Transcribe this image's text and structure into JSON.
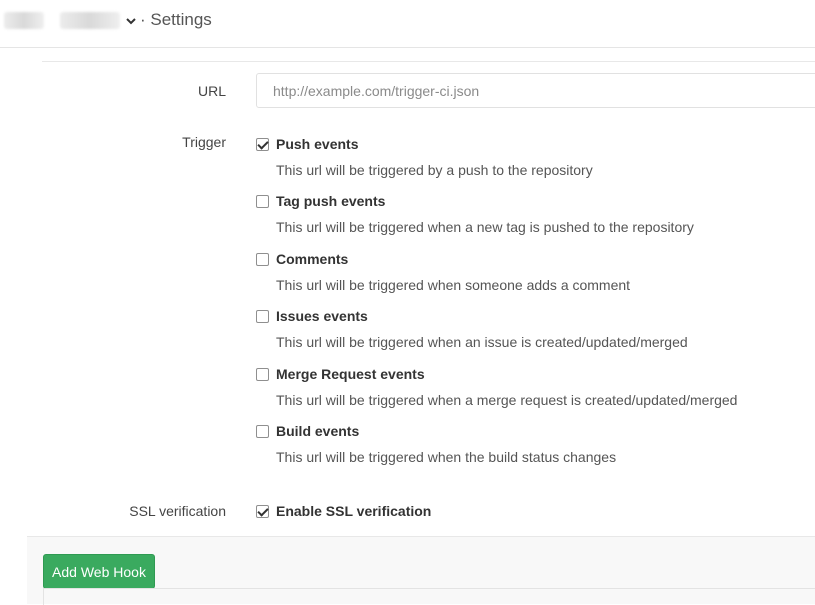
{
  "header": {
    "title": "· Settings",
    "dropdown_icon": "chevron-down-icon"
  },
  "form": {
    "url_label": "URL",
    "url_placeholder": "http://example.com/trigger-ci.json",
    "url_value": "",
    "trigger_label": "Trigger",
    "triggers": [
      {
        "title": "Push events",
        "help": "This url will be triggered by a push to the repository",
        "checked": true
      },
      {
        "title": "Tag push events",
        "help": "This url will be triggered when a new tag is pushed to the repository",
        "checked": false
      },
      {
        "title": "Comments",
        "help": "This url will be triggered when someone adds a comment",
        "checked": false
      },
      {
        "title": "Issues events",
        "help": "This url will be triggered when an issue is created/updated/merged",
        "checked": false
      },
      {
        "title": "Merge Request events",
        "help": "This url will be triggered when a merge request is created/updated/merged",
        "checked": false
      },
      {
        "title": "Build events",
        "help": "This url will be triggered when the build status changes",
        "checked": false
      }
    ],
    "ssl_label": "SSL verification",
    "ssl_option": {
      "title": "Enable SSL verification",
      "checked": true
    }
  },
  "actions": {
    "submit_label": "Add Web Hook",
    "submit_color": "#3aaa5f"
  }
}
